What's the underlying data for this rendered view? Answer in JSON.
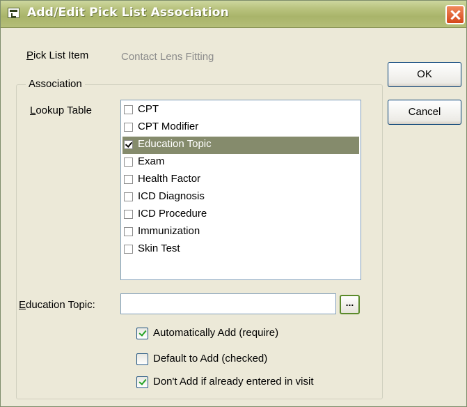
{
  "window": {
    "title": "Add/Edit Pick List Association",
    "icon": "dialog-icon",
    "close_icon": "close-icon"
  },
  "pick_list_item": {
    "label": "Pick List Item",
    "value": "Contact Lens Fitting"
  },
  "buttons": {
    "ok_label": "OK",
    "cancel_label": "Cancel"
  },
  "association": {
    "legend": "Association",
    "lookup_table_label": "Lookup Table",
    "lookup_items": [
      {
        "label": "CPT",
        "checked": false,
        "selected": false
      },
      {
        "label": "CPT Modifier",
        "checked": false,
        "selected": false
      },
      {
        "label": "Education Topic",
        "checked": true,
        "selected": true
      },
      {
        "label": "Exam",
        "checked": false,
        "selected": false
      },
      {
        "label": "Health Factor",
        "checked": false,
        "selected": false
      },
      {
        "label": "ICD Diagnosis",
        "checked": false,
        "selected": false
      },
      {
        "label": "ICD Procedure",
        "checked": false,
        "selected": false
      },
      {
        "label": "Immunization",
        "checked": false,
        "selected": false
      },
      {
        "label": "Skin Test",
        "checked": false,
        "selected": false
      }
    ],
    "education_topic_label": "Education Topic:",
    "education_topic_value": "",
    "browse_label": "...",
    "options": [
      {
        "label": "Automatically Add (require)",
        "checked": true
      },
      {
        "label": "Default to Add (checked)",
        "checked": false
      },
      {
        "label": "Don't Add if already entered in visit",
        "checked": true
      }
    ]
  },
  "colors": {
    "titlebar": "#b9c37e",
    "selection": "#858b6c",
    "dialog_bg": "#ece9d8"
  }
}
